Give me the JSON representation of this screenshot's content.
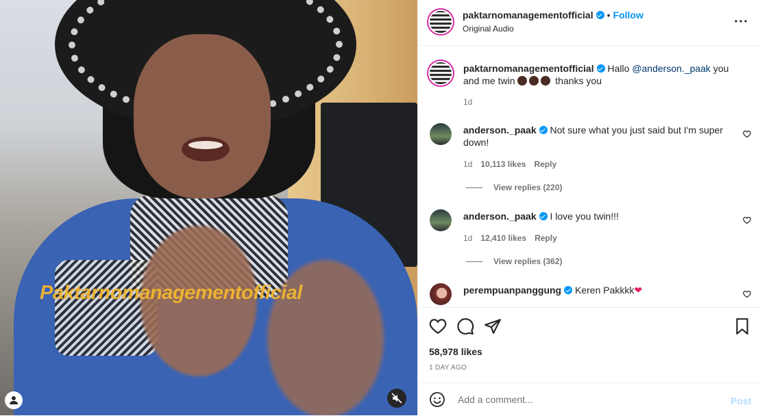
{
  "video": {
    "watermark": "Paktarnomanagementofficial"
  },
  "header": {
    "username": "paktarnomanagementofficial",
    "separator": "•",
    "follow_label": "Follow",
    "audio": "Original Audio",
    "more_label": "•••"
  },
  "caption": {
    "username": "paktarnomanagementofficial",
    "text_before": "Hallo ",
    "mention": "@anderson._paak",
    "text_after": " you and me twin",
    "text_end": " thanks you",
    "time": "1d"
  },
  "comments": [
    {
      "username": "anderson._paak",
      "text": "Not sure what you just said but I'm super down!",
      "time": "1d",
      "likes": "10,113 likes",
      "reply_label": "Reply",
      "view_replies": "View replies (220)"
    },
    {
      "username": "anderson._paak",
      "text": "I love you twin!!!",
      "time": "1d",
      "likes": "12,410 likes",
      "reply_label": "Reply",
      "view_replies": "View replies (362)"
    },
    {
      "username": "perempuanpanggung",
      "text": "Keren Pakkkk",
      "heart_emoji": "❤"
    }
  ],
  "actions": {
    "likes": "58,978 likes",
    "date": "1 DAY AGO"
  },
  "add_comment": {
    "placeholder": "Add a comment...",
    "post_label": "Post"
  },
  "colors": {
    "accent": "#0095f6",
    "watermark": "#f1b632",
    "post_disabled": "#b3dbff"
  }
}
